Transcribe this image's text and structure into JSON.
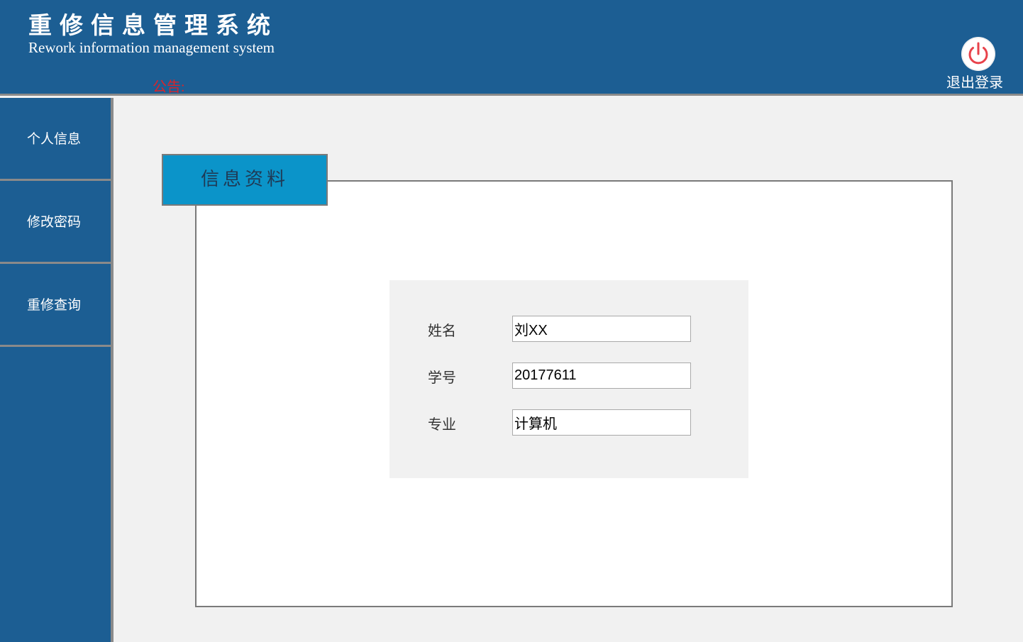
{
  "header": {
    "title_cn": "重修信息管理系统",
    "title_en": "Rework information management system",
    "notice_label": "公告:",
    "logout_label": "退出登录",
    "logout_icon": "power-icon",
    "notice_color": "#d9242b",
    "background": "#1c5e93"
  },
  "sidebar": {
    "items": [
      {
        "label": "个人信息"
      },
      {
        "label": "修改密码"
      },
      {
        "label": "重修查询"
      }
    ]
  },
  "main": {
    "tab_title": "信息资料",
    "tab_color": "#0b94c9",
    "fields": [
      {
        "label": "姓名",
        "value": "刘XX"
      },
      {
        "label": "学号",
        "value": "20177611"
      },
      {
        "label": "专业",
        "value": "计算机"
      }
    ]
  }
}
